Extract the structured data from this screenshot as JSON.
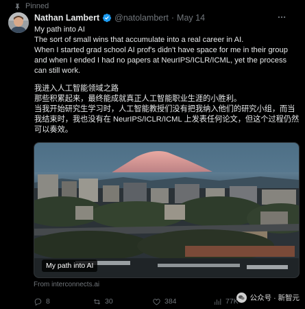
{
  "pinned_label": "Pinned",
  "author": {
    "name": "Nathan Lambert",
    "handle": "@natolambert",
    "separator": "·",
    "date": "May 14"
  },
  "tweet": {
    "lines_en": [
      "My path into AI",
      "The sort of small wins that accumulate into a real career in AI.",
      "When I started grad school AI prof's didn't have space for me in their group and when I ended I had no papers at NeurIPS/ICLR/ICML, yet the process can still work."
    ],
    "lines_zh": [
      "我进入人工智能领域之路",
      "那些积累起来，最终能成就真正人工智能职业生涯的小胜利。",
      "当我开始研究生学习时，人工智能教授们没有把我纳入他们的研究小组，而当我结束时，我也没有在 NeurIPS/ICLR/ICML 上发表任何论文，但这个过程仍然可以奏效。"
    ]
  },
  "card": {
    "label": "My path into AI",
    "source": "From interconnects.ai"
  },
  "actions": {
    "replies": "8",
    "reposts": "30",
    "likes": "384",
    "views": "77K"
  },
  "watermark": "公众号 · 新智元",
  "colors": {
    "background": "#000000",
    "text": "#e7e9ea",
    "secondary": "#71767b",
    "verified": "#1d9bf0"
  }
}
